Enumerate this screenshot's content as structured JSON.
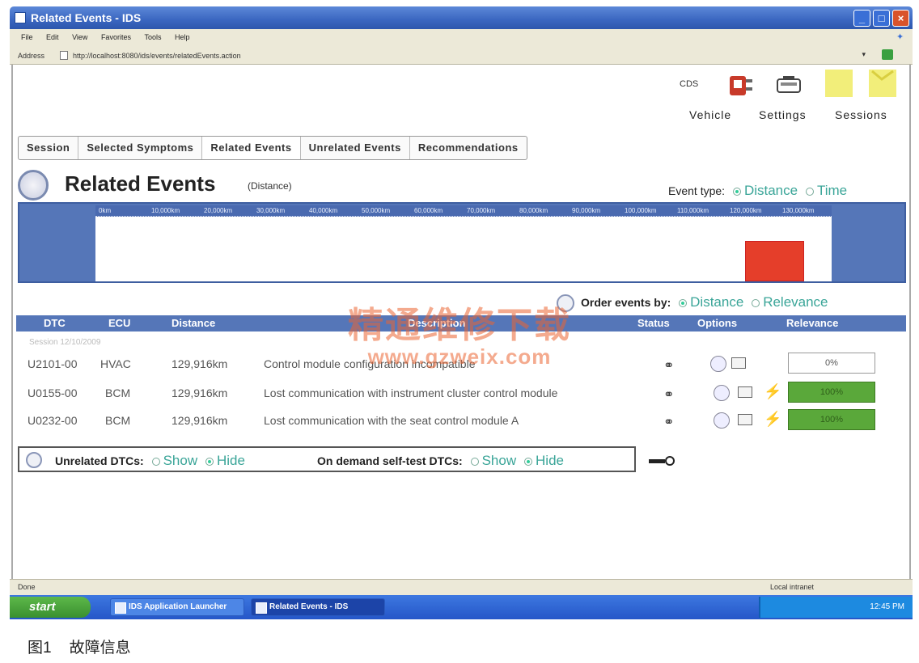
{
  "window": {
    "title": "Related Events - IDS"
  },
  "menu": [
    "File",
    "Edit",
    "View",
    "Favorites",
    "Tools",
    "Help"
  ],
  "address": {
    "label": "Address",
    "url": "http://localhost:8080/ids/events/relatedEvents.action"
  },
  "toolbar": {
    "vehicle": "Vehicle",
    "settings": "Settings",
    "sessions": "Sessions",
    "id_badge": "CDS"
  },
  "tabs": [
    "Session",
    "Selected Symptoms",
    "Related Events",
    "Unrelated Events",
    "Recommendations"
  ],
  "page": {
    "title": "Related Events",
    "subtitle": "(Distance)"
  },
  "event_type": {
    "label": "Event type:",
    "options": [
      "Distance",
      "Time"
    ],
    "selected": "Distance"
  },
  "timeline": {
    "ticks": [
      "0km",
      "10,000km",
      "20,000km",
      "30,000km",
      "40,000km",
      "50,000km",
      "60,000km",
      "70,000km",
      "80,000km",
      "90,000km",
      "100,000km",
      "110,000km",
      "120,000km",
      "130,000km"
    ],
    "max_km": 135000,
    "bar_from_km": 120000,
    "bar_to_km": 129916
  },
  "order_by": {
    "label": "Order events by:",
    "options": [
      "Distance",
      "Relevance"
    ],
    "selected": "Distance"
  },
  "table": {
    "headers": {
      "dtc": "DTC",
      "ecu": "ECU",
      "distance": "Distance",
      "description": "Description",
      "status": "Status",
      "options": "Options",
      "relevance": "Relevance"
    },
    "group_label": "Session 12/10/2009",
    "rows": [
      {
        "dtc": "U2101-00",
        "ecu": "HVAC",
        "distance": "129,916km",
        "description": "Control module configuration incompatible",
        "relevance": "0%",
        "high": false
      },
      {
        "dtc": "U0155-00",
        "ecu": "BCM",
        "distance": "129,916km",
        "description": "Lost communication with instrument cluster control module",
        "relevance": "100%",
        "high": true
      },
      {
        "dtc": "U0232-00",
        "ecu": "BCM",
        "distance": "129,916km",
        "description": "Lost communication with the seat control module A",
        "relevance": "100%",
        "high": true
      }
    ]
  },
  "filters": {
    "unrelated_label": "Unrelated DTCs:",
    "unrelated_options": [
      "Show",
      "Hide"
    ],
    "unrelated_selected": "Hide",
    "ondemand_label": "On demand self-test DTCs:",
    "ondemand_options": [
      "Show",
      "Hide"
    ],
    "ondemand_selected": "Hide"
  },
  "statusbar": {
    "left": "Done",
    "right": "Local intranet"
  },
  "taskbar": {
    "start": "start",
    "items": [
      "IDS Application Launcher",
      "Related Events - IDS"
    ],
    "time": "12:45 PM"
  },
  "watermark": {
    "line1": "精通维修下载",
    "line2": "www.gzweix.com"
  },
  "caption": {
    "fig": "图1",
    "text": "故障信息"
  },
  "colors": {
    "header_blue": "#5576b8",
    "bar_red": "#e53e2a",
    "relevance_green": "#5aa83a",
    "accent_teal": "#3aa598"
  }
}
